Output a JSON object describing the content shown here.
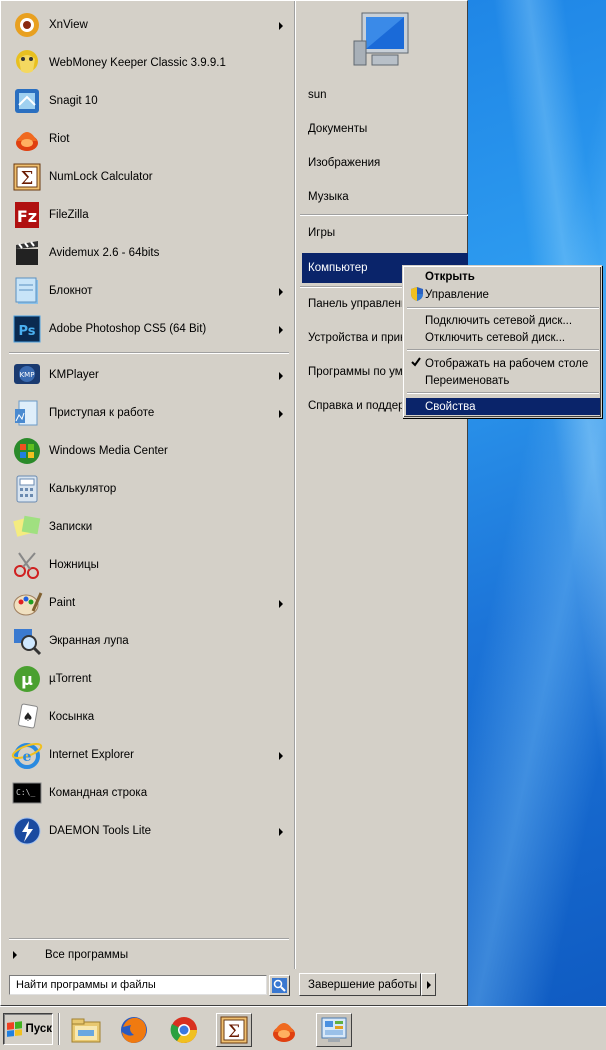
{
  "programs": [
    {
      "label": "XnView",
      "icon": "xnview-icon",
      "submenu": true
    },
    {
      "label": "WebMoney Keeper Classic 3.9.9.1",
      "icon": "webmoney-icon",
      "submenu": false
    },
    {
      "label": "Snagit 10",
      "icon": "snagit-icon",
      "submenu": false
    },
    {
      "label": "Riot",
      "icon": "riot-icon",
      "submenu": false
    },
    {
      "label": "NumLock Calculator",
      "icon": "numlock-calculator-icon",
      "submenu": false
    },
    {
      "label": "FileZilla",
      "icon": "filezilla-icon",
      "submenu": false
    },
    {
      "label": "Avidemux 2.6 - 64bits",
      "icon": "avidemux-icon",
      "submenu": false
    },
    {
      "label": "Блокнот",
      "icon": "notepad-icon",
      "submenu": true
    },
    {
      "label": "Adobe Photoshop CS5 (64 Bit)",
      "icon": "photoshop-icon",
      "submenu": true
    },
    {
      "label": "KMPlayer",
      "icon": "kmplayer-icon",
      "submenu": true
    },
    {
      "label": "Приступая к работе",
      "icon": "getting-started-icon",
      "submenu": true
    },
    {
      "label": "Windows Media Center",
      "icon": "media-center-icon",
      "submenu": false
    },
    {
      "label": "Калькулятор",
      "icon": "calculator-icon",
      "submenu": false
    },
    {
      "label": "Записки",
      "icon": "sticky-notes-icon",
      "submenu": false
    },
    {
      "label": "Ножницы",
      "icon": "snipping-tool-icon",
      "submenu": false
    },
    {
      "label": "Paint",
      "icon": "paint-icon",
      "submenu": true
    },
    {
      "label": "Экранная лупа",
      "icon": "magnifier-icon",
      "submenu": false
    },
    {
      "label": "µTorrent",
      "icon": "utorrent-icon",
      "submenu": false
    },
    {
      "label": "Косынка",
      "icon": "solitaire-icon",
      "submenu": false
    },
    {
      "label": "Internet Explorer",
      "icon": "internet-explorer-icon",
      "submenu": true
    },
    {
      "label": "Командная строка",
      "icon": "command-prompt-icon",
      "submenu": false
    },
    {
      "label": "DAEMON Tools Lite",
      "icon": "daemon-tools-icon",
      "submenu": true
    }
  ],
  "all_programs_label": "Все программы",
  "search_placeholder": "Найти программы и файлы",
  "places": [
    {
      "label": "sun"
    },
    {
      "label": "Документы"
    },
    {
      "label": "Изображения"
    },
    {
      "label": "Музыка"
    },
    {
      "label": "Игры"
    },
    {
      "label": "Компьютер",
      "selected": true
    },
    {
      "label": "Панель управления"
    },
    {
      "label": "Устройства и принтеры"
    },
    {
      "label": "Программы по умолчанию"
    },
    {
      "label": "Справка и поддержка"
    }
  ],
  "shutdown_label": "Завершение работы",
  "context_menu": [
    {
      "label": "Открыть",
      "bold": true
    },
    {
      "label": "Управление",
      "icon": "uac-shield-icon"
    },
    {
      "label": "Подключить сетевой диск..."
    },
    {
      "label": "Отключить сетевой диск..."
    },
    {
      "label": "Отображать на рабочем столе",
      "checked": true
    },
    {
      "label": "Переименовать"
    },
    {
      "label": "Свойства",
      "highlighted": true
    }
  ],
  "taskbar": {
    "start_label": "Пуск",
    "pinned": [
      "explorer-icon",
      "firefox-icon",
      "chrome-icon",
      "numlock-calculator-icon",
      "riot-icon",
      "control-panel-icon"
    ]
  },
  "colors": {
    "menu_face": "#d4d0c8",
    "selection": "#0a246a",
    "desktop": "#1f86e6"
  }
}
